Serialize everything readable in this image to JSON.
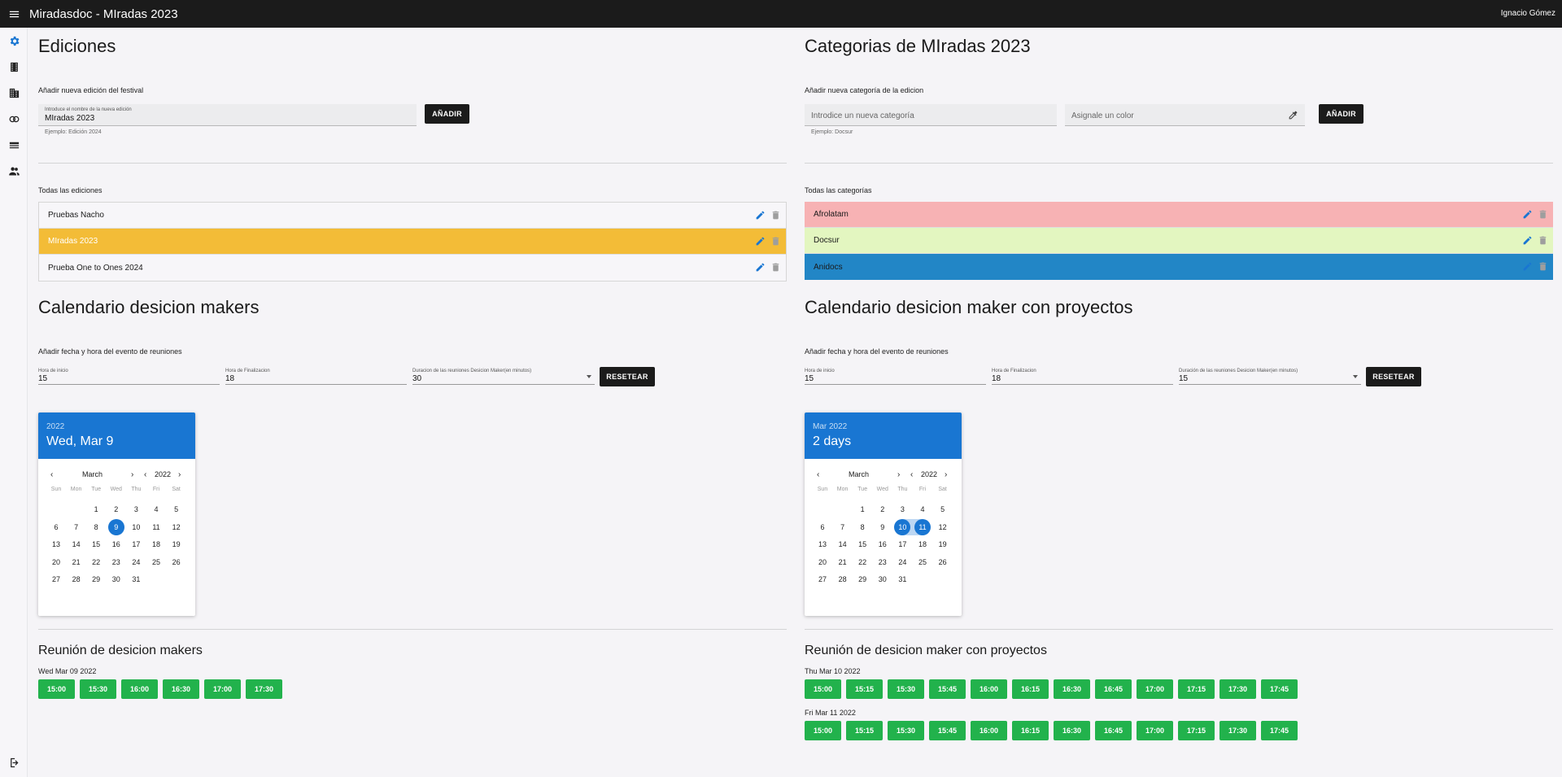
{
  "app": {
    "title": "Miradasdoc - MIradas 2023",
    "user": "Ignacio Gómez"
  },
  "sidebar": {
    "items": [
      {
        "icon": "gear-icon",
        "active": true
      },
      {
        "icon": "film-icon"
      },
      {
        "icon": "building-icon"
      },
      {
        "icon": "circles-icon"
      },
      {
        "icon": "layers-icon"
      },
      {
        "icon": "people-icon"
      }
    ],
    "logout_icon": "logout-icon"
  },
  "ediciones": {
    "title": "Ediciones",
    "add_label": "Añadir nueva edición del festival",
    "input_label": "Introduce el nombre de la nueva edición",
    "input_value": "MIradas 2023",
    "hint": "Ejemplo: Edición 2024",
    "add_button": "AÑADIR",
    "list_title": "Todas las ediciones",
    "items": [
      {
        "name": "Pruebas Nacho",
        "color": "#f7f6f9"
      },
      {
        "name": "MIradas 2023",
        "color": "#f3bc37",
        "selected": true
      },
      {
        "name": "Prueba One to Ones 2024",
        "color": "#f7f6f9"
      }
    ]
  },
  "categorias": {
    "title": "Categorias de MIradas 2023",
    "add_label": "Añadir nueva categoría de la edicion",
    "name_placeholder": "Introdice un nueva categoría",
    "color_placeholder": "Asignale un color",
    "hint": "Ejemplo: Docsur",
    "add_button": "AÑADIR",
    "list_title": "Todas las categorías",
    "items": [
      {
        "name": "Afrolatam",
        "color": "#f7b2b4"
      },
      {
        "name": "Docsur",
        "color": "#e3f6c0"
      },
      {
        "name": "Anidocs",
        "color": "#2286c6"
      }
    ]
  },
  "cal_dm": {
    "title": "Calendario desicion makers",
    "event_label": "Añadir fecha y hora del evento de reuniones",
    "start_label": "Hora de inicio",
    "start_value": "15",
    "end_label": "Hora de Finalizacion",
    "end_value": "18",
    "duration_label": "Duracion de las reuniones Desicion Maker(en minutos)",
    "duration_value": "30",
    "reset_button": "RESETEAR",
    "header_year": "2022",
    "header_date": "Wed, Mar 9",
    "month": "March",
    "year": "2022",
    "dow": [
      "Sun",
      "Mon",
      "Tue",
      "Wed",
      "Thu",
      "Fri",
      "Sat"
    ],
    "selected": [
      9
    ],
    "meeting_title": "Reunión de desicion makers",
    "days": [
      {
        "date": "Wed Mar 09 2022",
        "slots": [
          "15:00",
          "15:30",
          "16:00",
          "16:30",
          "17:00",
          "17:30"
        ]
      }
    ]
  },
  "cal_proj": {
    "title": "Calendario desicion maker con proyectos",
    "event_label": "Añadir fecha y hora del evento de reuniones",
    "start_label": "Hora de inicio",
    "start_value": "15",
    "end_label": "Hora de Finalizacion",
    "end_value": "18",
    "duration_label": "Duración de las reuniones Desicion Maker(en minutos)",
    "duration_value": "15",
    "reset_button": "RESETEAR",
    "header_year": "Mar 2022",
    "header_date": "2 days",
    "month": "March",
    "year": "2022",
    "dow": [
      "Sun",
      "Mon",
      "Tue",
      "Wed",
      "Thu",
      "Fri",
      "Sat"
    ],
    "selected": [
      10,
      11
    ],
    "meeting_title": "Reunión de desicion maker con proyectos",
    "days": [
      {
        "date": "Thu Mar 10 2022",
        "slots": [
          "15:00",
          "15:15",
          "15:30",
          "15:45",
          "16:00",
          "16:15",
          "16:30",
          "16:45",
          "17:00",
          "17:15",
          "17:30",
          "17:45"
        ]
      },
      {
        "date": "Fri Mar 11 2022",
        "slots": [
          "15:00",
          "15:15",
          "15:30",
          "15:45",
          "16:00",
          "16:15",
          "16:30",
          "16:45",
          "17:00",
          "17:15",
          "17:30",
          "17:45"
        ]
      }
    ]
  }
}
